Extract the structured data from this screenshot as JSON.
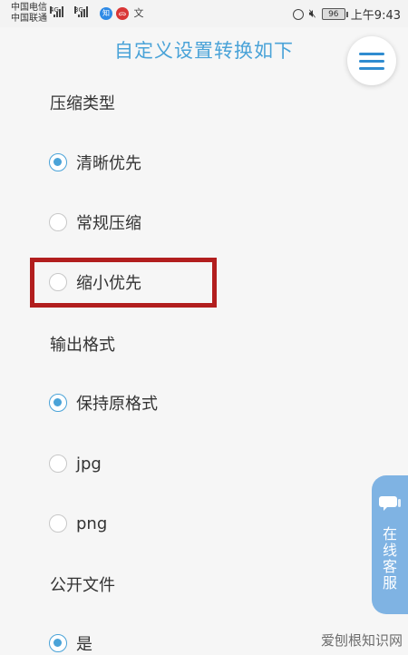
{
  "statusbar": {
    "carrier1": "中国电信",
    "carrier2": "中国联通",
    "sig1_label": "4G",
    "sig2_label": "3G",
    "app1": "知",
    "app2": "ᯅ",
    "app3": "文",
    "battery": "96",
    "time": "上午9:43"
  },
  "header": {
    "title": "自定义设置转换如下"
  },
  "compress": {
    "title": "压缩类型",
    "options": [
      {
        "label": "清晰优先",
        "checked": true
      },
      {
        "label": "常规压缩",
        "checked": false
      },
      {
        "label": "缩小优先",
        "checked": false
      }
    ]
  },
  "output": {
    "title": "输出格式",
    "options": [
      {
        "label": "保持原格式",
        "checked": true
      },
      {
        "label": "jpg",
        "checked": false
      },
      {
        "label": "png",
        "checked": false
      }
    ]
  },
  "public": {
    "title": "公开文件",
    "options": [
      {
        "label": "是",
        "checked": true
      }
    ]
  },
  "customer_service": {
    "label": "在线客服"
  },
  "watermark": "爱刨根知识网",
  "colors": {
    "accent": "#4aa3d8",
    "highlight": "#b21e1e",
    "cs_bg": "#7fb3e3"
  }
}
